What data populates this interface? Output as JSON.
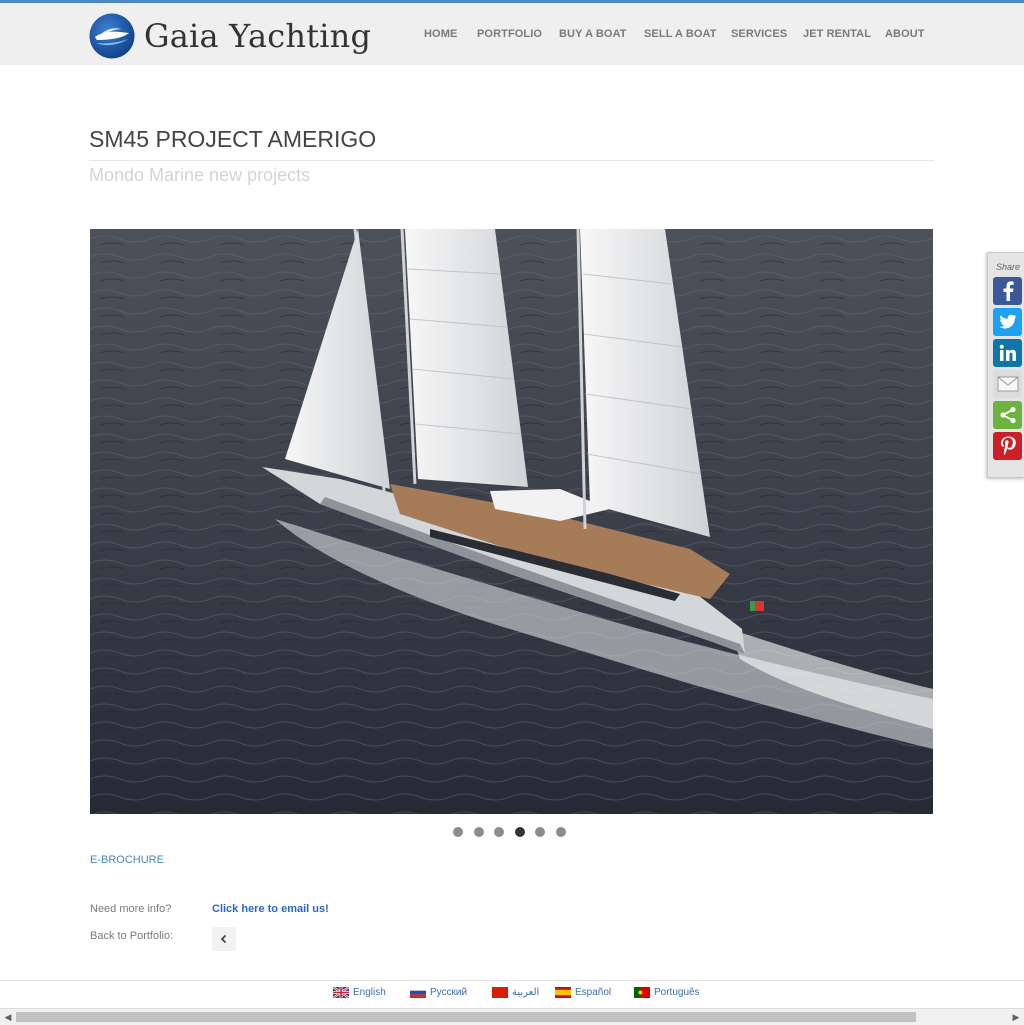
{
  "brand": {
    "name": "Gaia Yachting",
    "logo_icon": "yacht-globe-logo"
  },
  "colors": {
    "accent": "#4f86c6",
    "link": "#2a67c9",
    "header_bg": "#efefef",
    "nav_text": "#7a7a7a"
  },
  "nav": {
    "items": [
      {
        "label": "HOME"
      },
      {
        "label": "PORTFOLIO"
      },
      {
        "label": "BUY A BOAT"
      },
      {
        "label": "SELL A BOAT"
      },
      {
        "label": "SERVICES"
      },
      {
        "label": "JET RENTAL"
      },
      {
        "label": "ABOUT"
      }
    ]
  },
  "page": {
    "title": "SM45 PROJECT AMERIGO",
    "subtitle": "Mondo Marine new projects"
  },
  "carousel": {
    "slide_count": 6,
    "active_slide": 4
  },
  "links": {
    "ebrochure": "E-BROCHURE",
    "need_info_label": "Need more info?",
    "email_link": "Click here to email us!",
    "back_label": "Back to Portfolio:",
    "back_icon": "chevron-left-icon"
  },
  "share": {
    "label": "Share",
    "buttons": [
      {
        "icon": "facebook-icon",
        "color": "#3b5998"
      },
      {
        "icon": "twitter-icon",
        "color": "#1da1f2"
      },
      {
        "icon": "linkedin-icon",
        "color": "#0e76a8"
      },
      {
        "icon": "email-icon",
        "color": "#dcdcdc"
      },
      {
        "icon": "share-icon",
        "color": "#6cb33f"
      },
      {
        "icon": "pinterest-icon",
        "color": "#cb2027"
      }
    ]
  },
  "languages": [
    {
      "label": "English",
      "flag": "uk-flag-icon"
    },
    {
      "label": "Русский",
      "flag": "russia-flag-icon"
    },
    {
      "label": "العربية",
      "flag": "arabic-flag-icon"
    },
    {
      "label": "Español",
      "flag": "spain-flag-icon"
    },
    {
      "label": "Português",
      "flag": "portugal-flag-icon"
    }
  ]
}
